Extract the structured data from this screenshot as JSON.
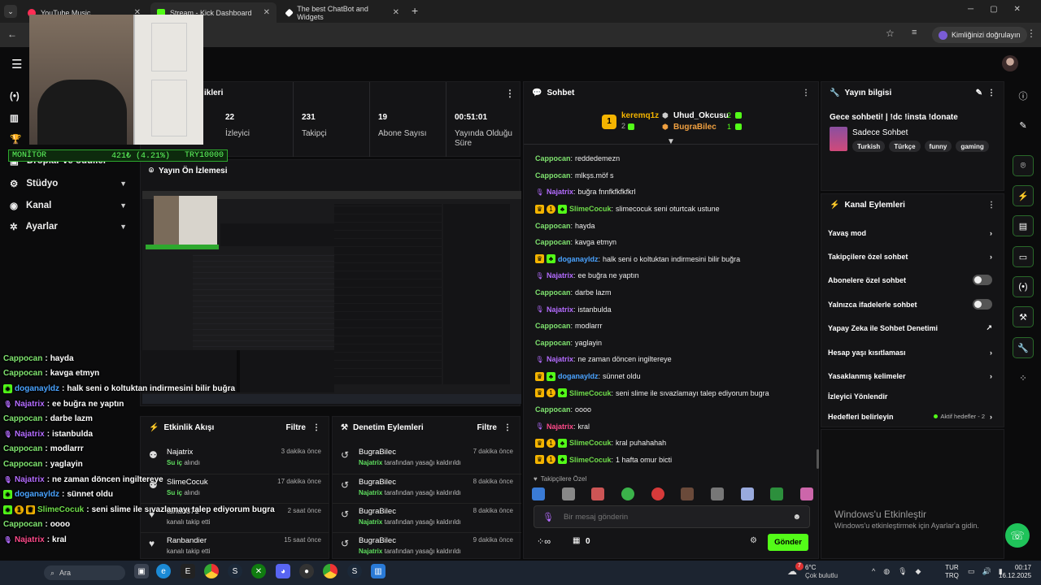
{
  "browser": {
    "tabs": [
      {
        "title": "YouTube Music",
        "color": "#ff2d55"
      },
      {
        "title": "Stream - Kick Dashboard",
        "color": "#53fc18"
      },
      {
        "title": "The best ChatBot and Widgets",
        "color": "#ffffff"
      }
    ],
    "identity_label": "Kimliğinizi doğrulayın"
  },
  "sidebar": {
    "items": [
      {
        "icon": "broadcast-icon",
        "label": ""
      },
      {
        "icon": "chart-icon",
        "label": ""
      },
      {
        "icon": "trophy-icon",
        "label": "Droplar ve ödüller"
      },
      {
        "icon": "studio-icon",
        "label": "Stüdyo"
      },
      {
        "icon": "channel-icon",
        "label": "Kanal"
      },
      {
        "icon": "gear-icon",
        "label": "Ayarlar"
      }
    ]
  },
  "monitor": {
    "label": "MONİTÖR",
    "change": "421₺ (4.21%)",
    "total": "TRY10000"
  },
  "stats": {
    "title_suffix": "ikleri",
    "items": [
      {
        "value": "22",
        "label": "İzleyici"
      },
      {
        "value": "231",
        "label": "Takipçi"
      },
      {
        "value": "19",
        "label": "Abone Sayısı"
      },
      {
        "value": "00:51:01",
        "label": "Yayında Olduğu Süre"
      }
    ]
  },
  "preview": {
    "title": "Yayın Ön İzlemesi"
  },
  "activity": {
    "title": "Etkinlik Akışı",
    "filter": "Filtre",
    "rows": [
      {
        "name": "Najatrix",
        "sub": "Su iç",
        "sub2": "alındı",
        "time": "3 dakika önce"
      },
      {
        "name": "SlimeCocuk",
        "sub": "Su iç",
        "sub2": "alındı",
        "time": "17 dakika önce"
      },
      {
        "name": "tuna3871",
        "sub": "",
        "sub2": "kanalı takip etti",
        "time": "2 saat önce"
      },
      {
        "name": "Ranbandier",
        "sub": "",
        "sub2": "kanalı takip etti",
        "time": "15 saat önce"
      }
    ]
  },
  "moderation": {
    "title": "Denetim Eylemleri",
    "filter": "Filtre",
    "rows": [
      {
        "name": "BugraBilec",
        "who": "Najatrix",
        "text": "tarafından yasağı kaldırıldı",
        "time": "7 dakika önce"
      },
      {
        "name": "BugraBilec",
        "who": "Najatrix",
        "text": "tarafından yasağı kaldırıldı",
        "time": "8 dakika önce"
      },
      {
        "name": "BugraBilec",
        "who": "Najatrix",
        "text": "tarafından yasağı kaldırıldı",
        "time": "8 dakika önce"
      },
      {
        "name": "BugraBilec",
        "who": "Najatrix",
        "text": "tarafından yasağı kaldırıldı",
        "time": "9 dakika önce"
      }
    ]
  },
  "chat": {
    "title": "Sohbet",
    "leaders": [
      {
        "name": "keremq1z",
        "rank": "1",
        "count": "2"
      },
      {
        "name": "Uhud_Okcusu",
        "count": "2"
      },
      {
        "name": "BugraBilec",
        "count": "1"
      }
    ],
    "messages": [
      {
        "user": "Cappocan",
        "color": "#7fe36f",
        "text": "reddedemezn",
        "badges": []
      },
      {
        "user": "Cappocan",
        "color": "#7fe36f",
        "text": "mlkşs.möf s",
        "badges": []
      },
      {
        "user": "Najatrix",
        "color": "#b46cff",
        "text": "buğra fnnfkfkfkfkrl",
        "badges": [
          "mic"
        ]
      },
      {
        "user": "SlimeCocuk",
        "color": "#6fdc4a",
        "text": "slimecocuk seni oturtcak ustune",
        "badges": [
          "crown",
          "one",
          "gift"
        ]
      },
      {
        "user": "Cappocan",
        "color": "#7fe36f",
        "text": "hayda",
        "badges": []
      },
      {
        "user": "Cappocan",
        "color": "#7fe36f",
        "text": "kavga etmyn",
        "badges": []
      },
      {
        "user": "doganayldz",
        "color": "#4aa3ff",
        "text": "halk seni o koltuktan indirmesini bilir buğra",
        "badges": [
          "crown",
          "gift"
        ]
      },
      {
        "user": "Najatrix",
        "color": "#b46cff",
        "text": "ee buğra ne yaptın",
        "badges": [
          "mic"
        ]
      },
      {
        "user": "Cappocan",
        "color": "#7fe36f",
        "text": "darbe lazm",
        "badges": []
      },
      {
        "user": "Najatrix",
        "color": "#b46cff",
        "text": "istanbulda",
        "badges": [
          "mic"
        ]
      },
      {
        "user": "Cappocan",
        "color": "#7fe36f",
        "text": "modlarrr",
        "badges": []
      },
      {
        "user": "Cappocan",
        "color": "#7fe36f",
        "text": "yaglayin",
        "badges": []
      },
      {
        "user": "Najatrix",
        "color": "#b46cff",
        "text": "ne zaman döncen ingiltereye",
        "badges": [
          "mic"
        ]
      },
      {
        "user": "doganayldz",
        "color": "#4aa3ff",
        "text": "sünnet oldu",
        "badges": [
          "crown",
          "gift"
        ]
      },
      {
        "user": "SlimeCocuk",
        "color": "#6fdc4a",
        "text": "seni slime ile sıvazlamayı talep ediyorum bugra",
        "badges": [
          "crown",
          "one",
          "gift"
        ]
      },
      {
        "user": "Cappocan",
        "color": "#7fe36f",
        "text": "oooo",
        "badges": []
      },
      {
        "user": "Najatrix",
        "color": "#ff4a8a",
        "text": "kral",
        "badges": [
          "mic"
        ]
      },
      {
        "user": "SlimeCocuk",
        "color": "#6fdc4a",
        "text": "kral puhahahah",
        "badges": [
          "crown",
          "one",
          "gift"
        ]
      },
      {
        "user": "SlimeCocuk",
        "color": "#6fdc4a",
        "text": "1 hafta omur bicti",
        "badges": [
          "crown",
          "one",
          "gift"
        ]
      }
    ],
    "followers_label": "Takipçilere Özel",
    "input_placeholder": "Bir mesaj gönderin",
    "points": "0",
    "send_label": "Gönder"
  },
  "stream_info": {
    "title": "Yayın bilgisi",
    "stream_title": "Gece sohbeti! | !dc !insta !donate",
    "category": "Sadece Sohbet",
    "tags": [
      "Turkish",
      "Türkçe",
      "funny",
      "gaming"
    ]
  },
  "channel_actions": {
    "title": "Kanal Eylemleri",
    "rows": [
      {
        "label": "Yavaş mod",
        "control": "chevron"
      },
      {
        "label": "Takipçilere özel sohbet",
        "control": "chevron"
      },
      {
        "label": "Abonelere özel sohbet",
        "control": "toggle"
      },
      {
        "label": "Yalnızca ifadelerle sohbet",
        "control": "toggle"
      },
      {
        "label": "Yapay Zeka ile Sohbet Denetimi",
        "control": "external"
      },
      {
        "label": "Hesap yaşı kısıtlaması",
        "control": "chevron"
      },
      {
        "label": "Yasaklanmış kelimeler",
        "control": "chevron"
      },
      {
        "label": "İzleyici Yönlendir",
        "control": "none"
      },
      {
        "label": "Hedefleri belirleyin",
        "control": "chevron",
        "badge": "Aktif hedefler - 2"
      }
    ]
  },
  "activation": {
    "title": "Windows'u Etkinleştir",
    "sub": "Windows'u etkinleştirmek için Ayarlar'a gidin."
  },
  "overlay_chat": [
    {
      "user": "Cappocan",
      "color": "#7fe36f",
      "text": "hayda",
      "badges": []
    },
    {
      "user": "Cappocan",
      "color": "#7fe36f",
      "text": "kavga etmyn",
      "badges": []
    },
    {
      "user": "doganayldz",
      "color": "#4aa3ff",
      "text": "halk seni o koltuktan indirmesini bilir buğra",
      "badges": [
        "gift"
      ]
    },
    {
      "user": "Najatrix",
      "color": "#b46cff",
      "text": "ee buğra ne yaptın",
      "badges": [
        "mic"
      ]
    },
    {
      "user": "Cappocan",
      "color": "#7fe36f",
      "text": "darbe lazm",
      "badges": []
    },
    {
      "user": "Najatrix",
      "color": "#b46cff",
      "text": "istanbulda",
      "badges": [
        "mic"
      ]
    },
    {
      "user": "Cappocan",
      "color": "#7fe36f",
      "text": "modlarrr",
      "badges": []
    },
    {
      "user": "Cappocan",
      "color": "#7fe36f",
      "text": "yaglayin",
      "badges": []
    },
    {
      "user": "Najatrix",
      "color": "#b46cff",
      "text": "ne zaman döncen ingiltereye",
      "badges": [
        "mic"
      ]
    },
    {
      "user": "doganayldz",
      "color": "#4aa3ff",
      "text": "sünnet oldu",
      "badges": [
        "gift"
      ]
    },
    {
      "user": "SlimeCocuk",
      "color": "#6fdc4a",
      "text": "seni slime ile sıvazlamayı talep ediyorum bugra",
      "badges": [
        "gift",
        "one",
        "crown"
      ]
    },
    {
      "user": "Cappocan",
      "color": "#7fe36f",
      "text": "oooo",
      "badges": []
    },
    {
      "user": "Najatrix",
      "color": "#ff4a8a",
      "text": "kral",
      "badges": [
        "mic"
      ]
    }
  ],
  "taskbar": {
    "search": "Ara",
    "weather_temp": "6°C",
    "weather_desc": "Çok bulutlu",
    "weather_badge": "7",
    "lang1": "TUR",
    "lang2": "TRQ",
    "time": "00:17",
    "date": "16.12.2025"
  }
}
